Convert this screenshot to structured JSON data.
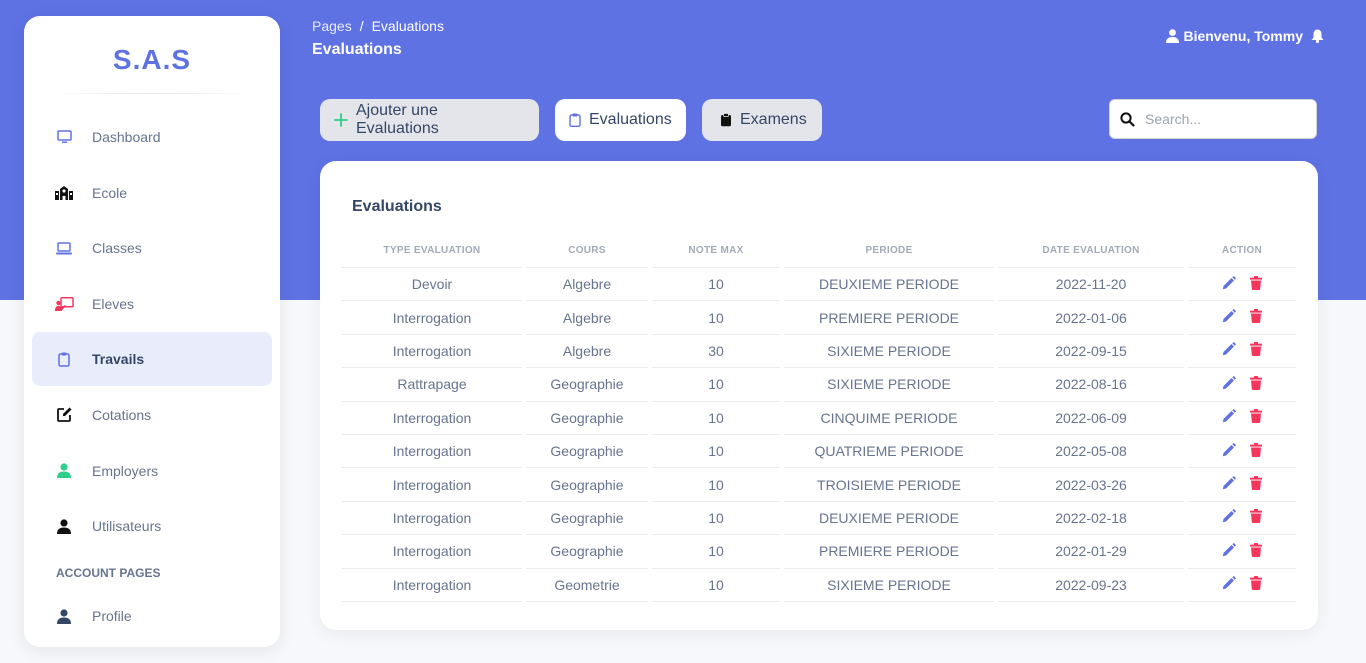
{
  "brand": "S.A.S",
  "sidebar": {
    "items": [
      {
        "label": "Dashboard",
        "icon": "monitor-icon",
        "color": "#5e72e4"
      },
      {
        "label": "Ecole",
        "icon": "school-icon",
        "color": "#111111"
      },
      {
        "label": "Classes",
        "icon": "laptop-icon",
        "color": "#5e72e4"
      },
      {
        "label": "Eleves",
        "icon": "chalkboard-teacher-icon",
        "color": "#f5365c"
      },
      {
        "label": "Travails",
        "icon": "clipboard-icon",
        "color": "#5e72e4"
      },
      {
        "label": "Cotations",
        "icon": "edit-icon",
        "color": "#111111"
      },
      {
        "label": "Employers",
        "icon": "user-icon",
        "color": "#2dce89"
      },
      {
        "label": "Utilisateurs",
        "icon": "user-icon",
        "color": "#111111"
      }
    ],
    "section_title": "ACCOUNT PAGES",
    "account_items": [
      {
        "label": "Profile",
        "icon": "user-icon",
        "color": "#344767"
      }
    ]
  },
  "header": {
    "breadcrumb_root": "Pages",
    "breadcrumb_sep": "/",
    "breadcrumb_current": "Evaluations",
    "title": "Evaluations",
    "user_greeting": "Bienvenu, Tommy"
  },
  "toolbar": {
    "add_label": "Ajouter une Evaluations",
    "evaluations_label": "Evaluations",
    "exams_label": "Examens"
  },
  "search": {
    "placeholder": "Search..."
  },
  "card": {
    "title": "Evaluations",
    "columns": [
      "TYPE EVALUATION",
      "COURS",
      "NOTE MAX",
      "PERIODE",
      "DATE EVALUATION",
      "ACTION"
    ],
    "rows": [
      [
        "Devoir",
        "Algebre",
        "10",
        "DEUXIEME PERIODE",
        "2022-11-20"
      ],
      [
        "Interrogation",
        "Algebre",
        "10",
        "PREMIERE PERIODE",
        "2022-01-06"
      ],
      [
        "Interrogation",
        "Algebre",
        "30",
        "SIXIEME PERIODE",
        "2022-09-15"
      ],
      [
        "Rattrapage",
        "Geographie",
        "10",
        "SIXIEME PERIODE",
        "2022-08-16"
      ],
      [
        "Interrogation",
        "Geographie",
        "10",
        "CINQUIME PERIODE",
        "2022-06-09"
      ],
      [
        "Interrogation",
        "Geographie",
        "10",
        "QUATRIEME PERIODE",
        "2022-05-08"
      ],
      [
        "Interrogation",
        "Geographie",
        "10",
        "TROISIEME PERIODE",
        "2022-03-26"
      ],
      [
        "Interrogation",
        "Geographie",
        "10",
        "DEUXIEME PERIODE",
        "2022-02-18"
      ],
      [
        "Interrogation",
        "Geographie",
        "10",
        "PREMIERE PERIODE",
        "2022-01-29"
      ],
      [
        "Interrogation",
        "Geometrie",
        "10",
        "SIXIEME PERIODE",
        "2022-09-23"
      ]
    ]
  },
  "colors": {
    "primary": "#5e72e4",
    "danger": "#f5365c",
    "success": "#2dce89"
  }
}
